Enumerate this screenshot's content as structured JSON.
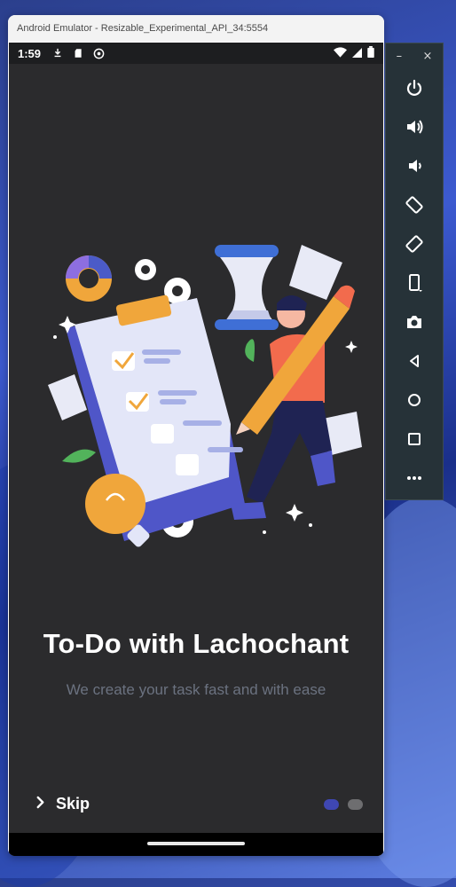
{
  "window": {
    "title": "Android Emulator - Resizable_Experimental_API_34:5554"
  },
  "statusbar": {
    "time": "1:59"
  },
  "onboarding": {
    "title": "To-Do with Lachochant",
    "subtitle": "We create your task fast and with ease",
    "skip_label": "Skip",
    "page_dots": {
      "count": 2,
      "active_index": 0
    }
  },
  "toolbar": {
    "minimize_glyph": "–",
    "close_glyph": "×",
    "items": [
      "power-icon",
      "volume-up-icon",
      "volume-down-icon",
      "rotate-left-icon",
      "rotate-right-icon",
      "fold-icon",
      "camera-icon",
      "back-icon",
      "home-icon",
      "overview-icon",
      "more-icon"
    ]
  },
  "colors": {
    "phone_bg": "#2b2b2d",
    "accent": "#3f47b3",
    "subtitle_text": "#6b7280"
  }
}
